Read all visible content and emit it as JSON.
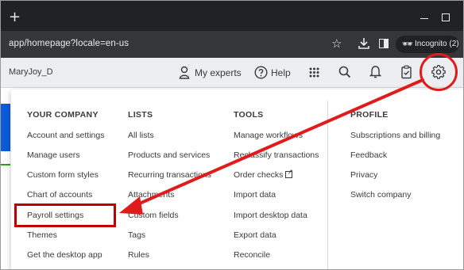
{
  "browser": {
    "new_tab_glyph": "+",
    "url": "app/homepage?locale=en-us",
    "incognito_label": "Incognito (2)"
  },
  "header": {
    "user": "MaryJoy_D",
    "my_experts": "My experts",
    "help": "Help"
  },
  "menu": {
    "your_company": {
      "title": "YOUR COMPANY",
      "items": [
        "Account and settings",
        "Manage users",
        "Custom form styles",
        "Chart of accounts",
        "Payroll settings",
        "Themes",
        "Get the desktop app"
      ]
    },
    "lists": {
      "title": "LISTS",
      "items": [
        "All lists",
        "Products and services",
        "Recurring transactions",
        "Attachments",
        "Custom fields",
        "Tags",
        "Rules"
      ]
    },
    "tools": {
      "title": "TOOLS",
      "items": [
        "Manage workflows",
        "Reclassify transactions",
        "Order checks",
        "Import data",
        "Import desktop data",
        "Export data",
        "Reconcile"
      ]
    },
    "profile": {
      "title": "PROFILE",
      "items": [
        "Subscriptions and billing",
        "Feedback",
        "Privacy",
        "Switch company"
      ]
    }
  },
  "icons": {
    "expert": "person-pin-icon",
    "help": "help-circle-icon",
    "apps": "grid-icon",
    "search": "search-icon",
    "notifications": "bell-icon",
    "tasks": "clipboard-check-icon",
    "settings": "gear-icon"
  },
  "colors": {
    "annotation_red": "#c00000",
    "titlebar": "#202124",
    "addressbar": "#35363a",
    "header_bg": "#eceef1"
  }
}
